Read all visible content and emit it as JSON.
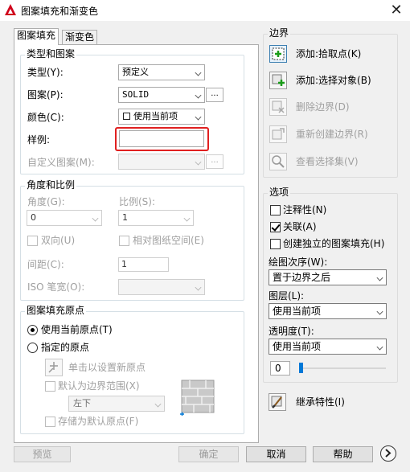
{
  "window": {
    "title": "图案填充和渐变色",
    "close": "✕"
  },
  "tabs": [
    {
      "label": "图案填充"
    },
    {
      "label": "渐变色"
    }
  ],
  "type_pattern": {
    "title": "类型和图案",
    "type_label": "类型(Y):",
    "type_value": "预定义",
    "pattern_label": "图案(P):",
    "pattern_value": "SOLID",
    "pattern_browse": "...",
    "color_label": "颜色(C):",
    "color_value": "使用当前项",
    "swatch_label": "样例:",
    "custom_label": "自定义图案(M):",
    "custom_browse": "..."
  },
  "angle_scale": {
    "title": "角度和比例",
    "angle_label": "角度(G):",
    "angle_value": "0",
    "scale_label": "比例(S):",
    "scale_value": "1",
    "double_label": "双向(U)",
    "relative_label": "相对图纸空间(E)",
    "spacing_label": "间距(C):",
    "spacing_value": "1",
    "iso_label": "ISO 笔宽(O):"
  },
  "origin": {
    "title": "图案填充原点",
    "current_label": "使用当前原点(T)",
    "specified_label": "指定的原点",
    "click_set_label": "单击以设置新原点",
    "default_extents_label": "默认为边界范围(X)",
    "extents_value": "左下",
    "store_default_label": "存储为默认原点(F)"
  },
  "boundary": {
    "title": "边界",
    "add_pick": "添加:拾取点(K)",
    "add_select": "添加:选择对象(B)",
    "remove": "删除边界(D)",
    "recreate": "重新创建边界(R)",
    "view": "查看选择集(V)"
  },
  "options": {
    "title": "选项",
    "annotative": "注释性(N)",
    "associative": "关联(A)",
    "separate": "创建独立的图案填充(H)",
    "draw_order_label": "绘图次序(W):",
    "draw_order_value": "置于边界之后",
    "layer_label": "图层(L):",
    "layer_value": "使用当前项",
    "transparency_label": "透明度(T):",
    "transparency_value": "使用当前项",
    "transparency_amount": "0",
    "transparency_fraction": 0
  },
  "inherit": {
    "label": "继承特性(I)"
  },
  "footer": {
    "preview": "预览",
    "ok": "确定",
    "cancel": "取消",
    "help": "帮助"
  },
  "colors": {
    "highlight": "#e02020",
    "accent": "#0078d7"
  }
}
